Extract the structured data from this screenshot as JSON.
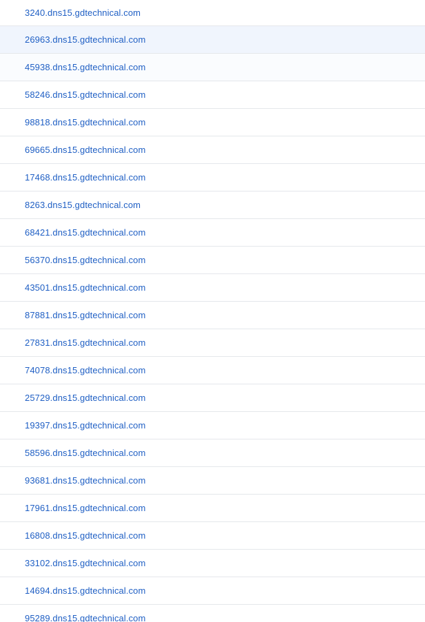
{
  "hosts": [
    "3240.dns15.gdtechnical.com",
    "26963.dns15.gdtechnical.com",
    "45938.dns15.gdtechnical.com",
    "58246.dns15.gdtechnical.com",
    "98818.dns15.gdtechnical.com",
    "69665.dns15.gdtechnical.com",
    "17468.dns15.gdtechnical.com",
    "8263.dns15.gdtechnical.com",
    "68421.dns15.gdtechnical.com",
    "56370.dns15.gdtechnical.com",
    "43501.dns15.gdtechnical.com",
    "87881.dns15.gdtechnical.com",
    "27831.dns15.gdtechnical.com",
    "74078.dns15.gdtechnical.com",
    "25729.dns15.gdtechnical.com",
    "19397.dns15.gdtechnical.com",
    "58596.dns15.gdtechnical.com",
    "93681.dns15.gdtechnical.com",
    "17961.dns15.gdtechnical.com",
    "16808.dns15.gdtechnical.com",
    "33102.dns15.gdtechnical.com",
    "14694.dns15.gdtechnical.com",
    "95289.dns15.gdtechnical.com"
  ],
  "colors": {
    "link": "#1f5fc4",
    "hover_row": "#f0f5fd",
    "divider": "#e4e7eb"
  }
}
